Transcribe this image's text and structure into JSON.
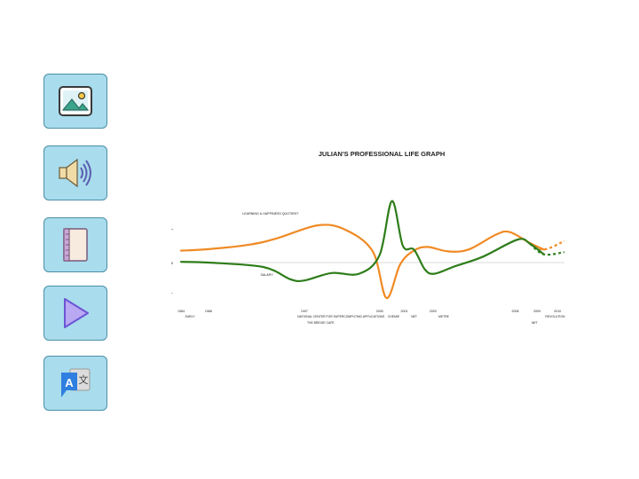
{
  "sidebar": {
    "items": [
      {
        "icon": "image-icon",
        "kind": "image"
      },
      {
        "icon": "speaker-icon",
        "kind": "audio"
      },
      {
        "icon": "notebook-icon",
        "kind": "notes"
      },
      {
        "icon": "play-icon",
        "kind": "video"
      },
      {
        "icon": "translate-icon",
        "kind": "translate",
        "glyph_a": "A",
        "glyph_b": "文"
      }
    ],
    "colors": {
      "tile_bg": "#a9dcec",
      "tile_border": "#4a8fa8"
    }
  },
  "chart_data": {
    "type": "line",
    "title": "JULIAN'S PROFESSIONAL LIFE GRAPH",
    "xlabel": "",
    "ylabel": "",
    "xlim": [
      1984,
      2012
    ],
    "ylim": [
      -1,
      1
    ],
    "grid": false,
    "y_tick_marks": [
      "+",
      "0",
      "−"
    ],
    "x_ticks": [
      "1984",
      "1986",
      "1997",
      "2000",
      "2001",
      "2003",
      "2008",
      "2009",
      "2010"
    ],
    "x_tick_values": [
      1984,
      1986,
      1993,
      1998.5,
      2000.3,
      2002.4,
      2008.4,
      2010,
      2011.5
    ],
    "periods": [
      {
        "label": "EARLY",
        "x": 1984.3,
        "row": 1
      },
      {
        "label": "NATIONAL CENTER FOR SUPERCOMPUTING APPLICATIONS",
        "x": 1992.5,
        "row": 1
      },
      {
        "label": "CHEMIE",
        "x": 1999.1,
        "row": 1
      },
      {
        "label": "NET",
        "x": 2000.8,
        "row": 1
      },
      {
        "label": "METRE",
        "x": 2002.8,
        "row": 1
      },
      {
        "label": "REVOLUTION",
        "x": 2010.6,
        "row": 1
      },
      {
        "label": "THE BRIDGE CAFE",
        "x": 1993.2,
        "row": 2
      },
      {
        "label": "NET",
        "x": 2009.6,
        "row": 2
      }
    ],
    "series": [
      {
        "name": "LEARNING & HAPPINESS QUOTIENT",
        "color": "#f08a24",
        "x": [
          1984,
          1986,
          1989,
          1991,
          1994,
          1996,
          1998,
          1999,
          2000,
          2001,
          2002,
          2003.5,
          2005,
          2007,
          2008,
          2009.5,
          2010.5,
          2012
        ],
        "y": [
          0.32,
          0.36,
          0.48,
          0.65,
          1.0,
          0.88,
          0.3,
          -0.95,
          -0.05,
          0.32,
          0.42,
          0.3,
          0.35,
          0.75,
          0.82,
          0.52,
          0.35,
          0.58
        ],
        "projected_from": 2010.3
      },
      {
        "name": "SALARY",
        "color": "#2e7d1a",
        "x": [
          1984,
          1986,
          1990,
          1992,
          1993,
          1995,
          1997,
          1998.5,
          1999.4,
          2000.2,
          2001,
          2001.8,
          2002.5,
          2004,
          2006,
          2008.6,
          2009.5,
          2010.5,
          2012
        ],
        "y": [
          0.02,
          0.0,
          -0.12,
          -0.45,
          -0.48,
          -0.28,
          -0.3,
          0.2,
          1.65,
          0.45,
          0.35,
          -0.18,
          -0.3,
          -0.1,
          0.15,
          0.62,
          0.5,
          0.22,
          0.28
        ],
        "projected_from": 2010.3
      }
    ],
    "annotations": [
      {
        "text": "LEARNING & HAPPINESS QUOTIENT",
        "x": 1988.5,
        "y": 1.28,
        "series": 0
      },
      {
        "text": "SALARY",
        "x": 1989.8,
        "y": -0.36,
        "series": 1
      }
    ]
  }
}
